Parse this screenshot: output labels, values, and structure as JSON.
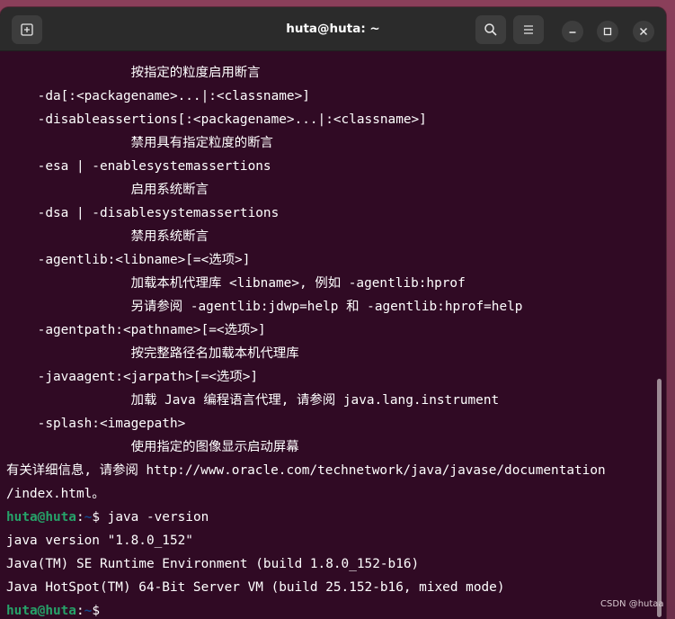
{
  "window": {
    "title": "huta@huta: ~"
  },
  "terminal": {
    "lines": [
      {
        "text": "                按指定的粒度启用断言"
      },
      {
        "text": "    -da[:<packagename>...|:<classname>]"
      },
      {
        "text": "    -disableassertions[:<packagename>...|:<classname>]"
      },
      {
        "text": "                禁用具有指定粒度的断言"
      },
      {
        "text": "    -esa | -enablesystemassertions"
      },
      {
        "text": "                启用系统断言"
      },
      {
        "text": "    -dsa | -disablesystemassertions"
      },
      {
        "text": "                禁用系统断言"
      },
      {
        "text": "    -agentlib:<libname>[=<选项>]"
      },
      {
        "text": "                加载本机代理库 <libname>, 例如 -agentlib:hprof"
      },
      {
        "text": "                另请参阅 -agentlib:jdwp=help 和 -agentlib:hprof=help"
      },
      {
        "text": "    -agentpath:<pathname>[=<选项>]"
      },
      {
        "text": "                按完整路径名加载本机代理库"
      },
      {
        "text": "    -javaagent:<jarpath>[=<选项>]"
      },
      {
        "text": "                加载 Java 编程语言代理, 请参阅 java.lang.instrument"
      },
      {
        "text": "    -splash:<imagepath>"
      },
      {
        "text": "                使用指定的图像显示启动屏幕"
      },
      {
        "text": "有关详细信息, 请参阅 http://www.oracle.com/technetwork/java/javase/documentation"
      },
      {
        "text": "/index.html。"
      },
      {
        "text": "java version \"1.8.0_152\""
      },
      {
        "text": "Java(TM) SE Runtime Environment (build 1.8.0_152-b16)"
      },
      {
        "text": "Java HotSpot(TM) 64-Bit Server VM (build 25.152-b16, mixed mode)"
      }
    ],
    "prompt1": {
      "user": "huta@huta",
      "sep": ":",
      "path": "~",
      "symbol": "$ ",
      "command": "java -version"
    },
    "prompt2": {
      "user": "huta@huta",
      "sep": ":",
      "path": "~",
      "symbol": "$ ",
      "command": ""
    }
  },
  "watermark": "CSDN @hutaa",
  "icons": {
    "new_tab": "new-tab-icon",
    "search": "search-icon",
    "menu": "hamburger-menu-icon",
    "minimize": "minimize-icon",
    "maximize": "maximize-icon",
    "close": "close-icon"
  },
  "colors": {
    "terminal_bg": "#300a24",
    "prompt_user": "#26a269",
    "prompt_path": "#12488b",
    "titlebar_bg": "#2b2b2b"
  }
}
